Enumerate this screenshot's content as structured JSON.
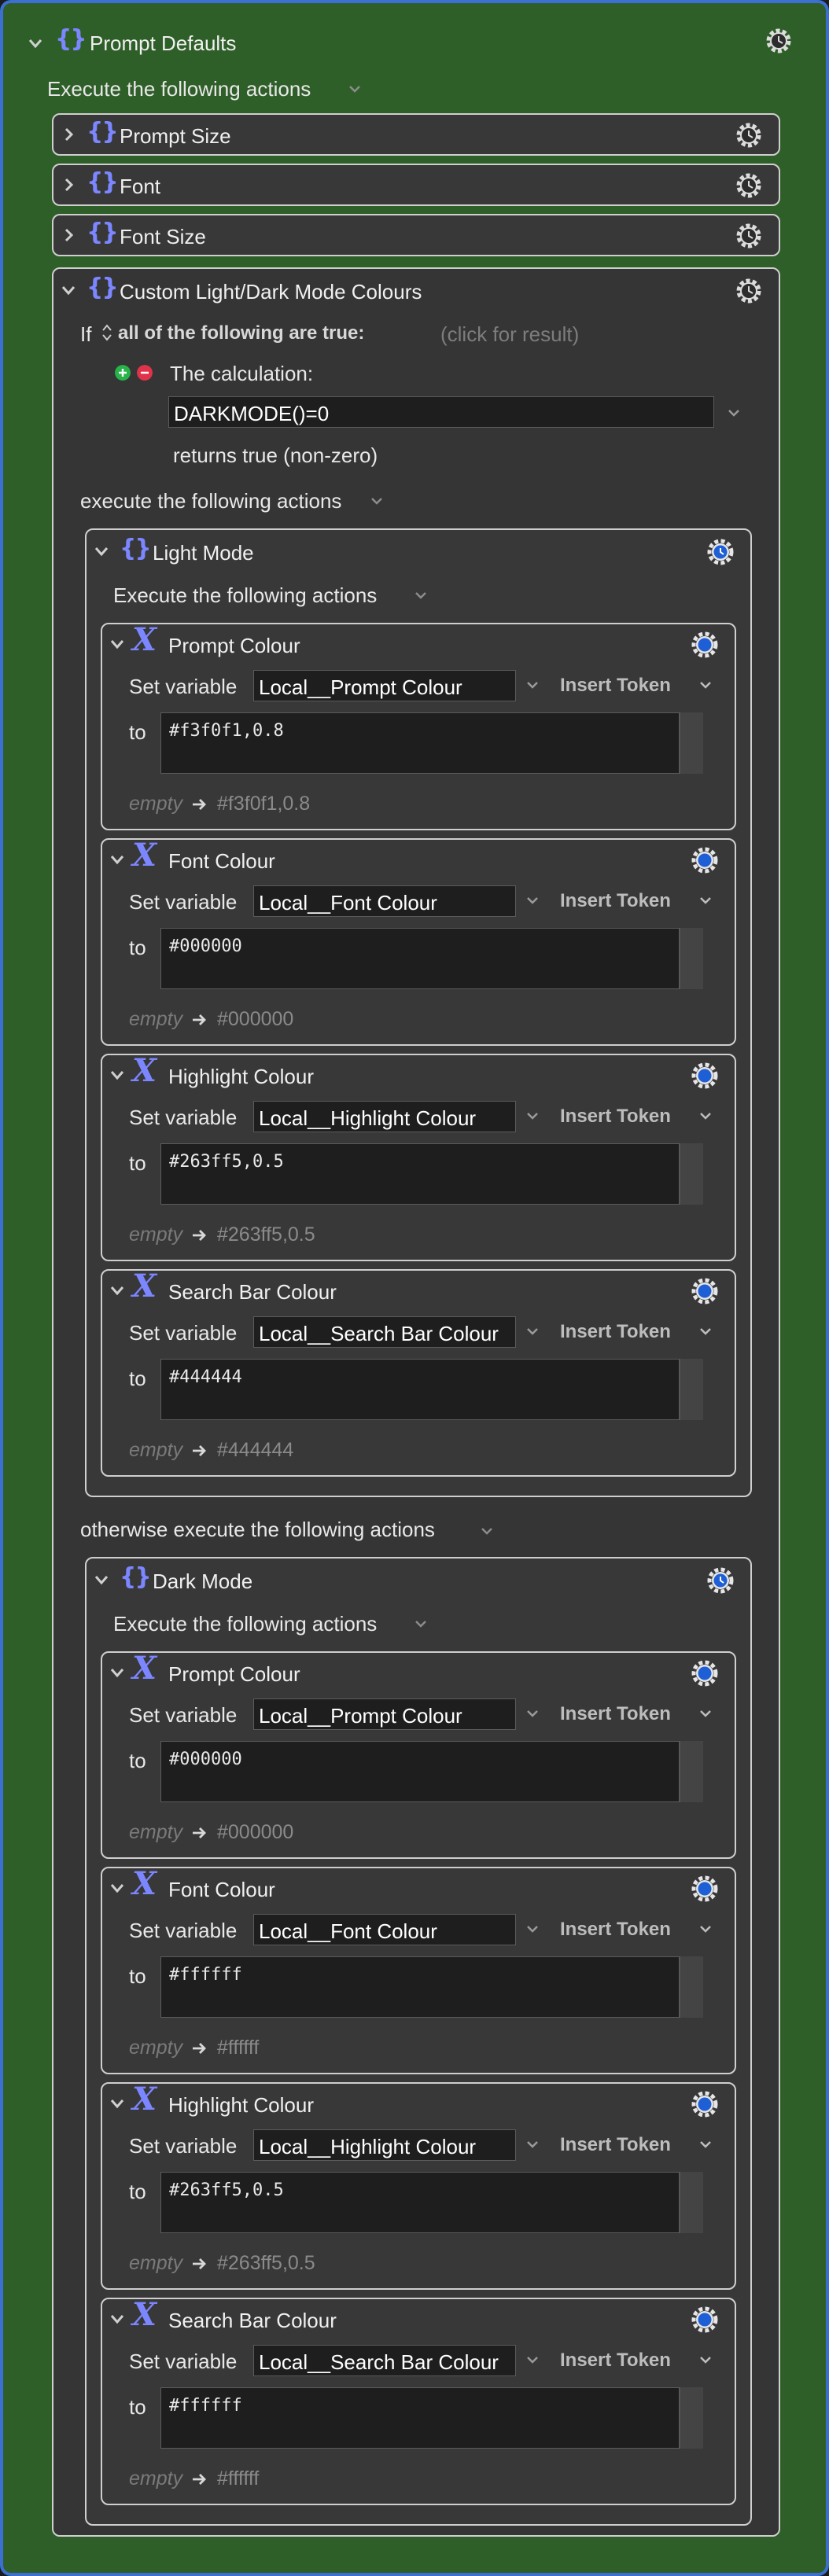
{
  "macro": {
    "title": "Prompt Defaults",
    "execute_label": "Execute the following actions"
  },
  "collapsed": [
    {
      "title": "Prompt Size"
    },
    {
      "title": "Font"
    },
    {
      "title": "Font Size"
    }
  ],
  "custom": {
    "title": "Custom Light/Dark Mode Colours",
    "if_label": "If",
    "condition_mode": "all of the following are true:",
    "click_hint": "(click for result)",
    "calc_label": "The calculation:",
    "calc_value": "DARKMODE()=0",
    "returns_label": "returns true (non-zero)",
    "then_label": "execute the following actions",
    "else_label": "otherwise execute the following actions"
  },
  "groups": [
    {
      "title": "Light Mode",
      "execute_label": "Execute the following actions",
      "actions": [
        {
          "title": "Prompt Colour",
          "set_label": "Set variable",
          "variable": "Local__Prompt Colour",
          "insert_token": "Insert Token",
          "to_label": "to",
          "value": "#f3f0f1,0.8",
          "empty_label": "empty",
          "result": "#f3f0f1,0.8"
        },
        {
          "title": "Font Colour",
          "set_label": "Set variable",
          "variable": "Local__Font Colour",
          "insert_token": "Insert Token",
          "to_label": "to",
          "value": "#000000",
          "empty_label": "empty",
          "result": "#000000"
        },
        {
          "title": "Highlight Colour",
          "set_label": "Set variable",
          "variable": "Local__Highlight Colour",
          "insert_token": "Insert Token",
          "to_label": "to",
          "value": "#263ff5,0.5",
          "empty_label": "empty",
          "result": "#263ff5,0.5"
        },
        {
          "title": "Search Bar Colour",
          "set_label": "Set variable",
          "variable": "Local__Search Bar Colour",
          "insert_token": "Insert Token",
          "to_label": "to",
          "value": "#444444",
          "empty_label": "empty",
          "result": "#444444"
        }
      ]
    },
    {
      "title": "Dark Mode",
      "execute_label": "Execute the following actions",
      "actions": [
        {
          "title": "Prompt Colour",
          "set_label": "Set variable",
          "variable": "Local__Prompt Colour",
          "insert_token": "Insert Token",
          "to_label": "to",
          "value": "#000000",
          "empty_label": "empty",
          "result": "#000000"
        },
        {
          "title": "Font Colour",
          "set_label": "Set variable",
          "variable": "Local__Font Colour",
          "insert_token": "Insert Token",
          "to_label": "to",
          "value": "#ffffff",
          "empty_label": "empty",
          "result": "#ffffff"
        },
        {
          "title": "Highlight Colour",
          "set_label": "Set variable",
          "variable": "Local__Highlight Colour",
          "insert_token": "Insert Token",
          "to_label": "to",
          "value": "#263ff5,0.5",
          "empty_label": "empty",
          "result": "#263ff5,0.5"
        },
        {
          "title": "Search Bar Colour",
          "set_label": "Set variable",
          "variable": "Local__Search Bar Colour",
          "insert_token": "Insert Token",
          "to_label": "to",
          "value": "#ffffff",
          "empty_label": "empty",
          "result": "#ffffff"
        }
      ]
    }
  ],
  "colors": {
    "macro_background": "#2f5f28",
    "selection_border": "#3c6fd2",
    "icon_accent": "#7b86ff",
    "gear_blue": "#1f5fd6"
  },
  "icons": {
    "group": "curly-braces-icon",
    "variable": "variable-x-icon",
    "gear": "gear-icon",
    "gear_clock": "gear-clock-icon",
    "disclosure": "chevron-icon"
  }
}
